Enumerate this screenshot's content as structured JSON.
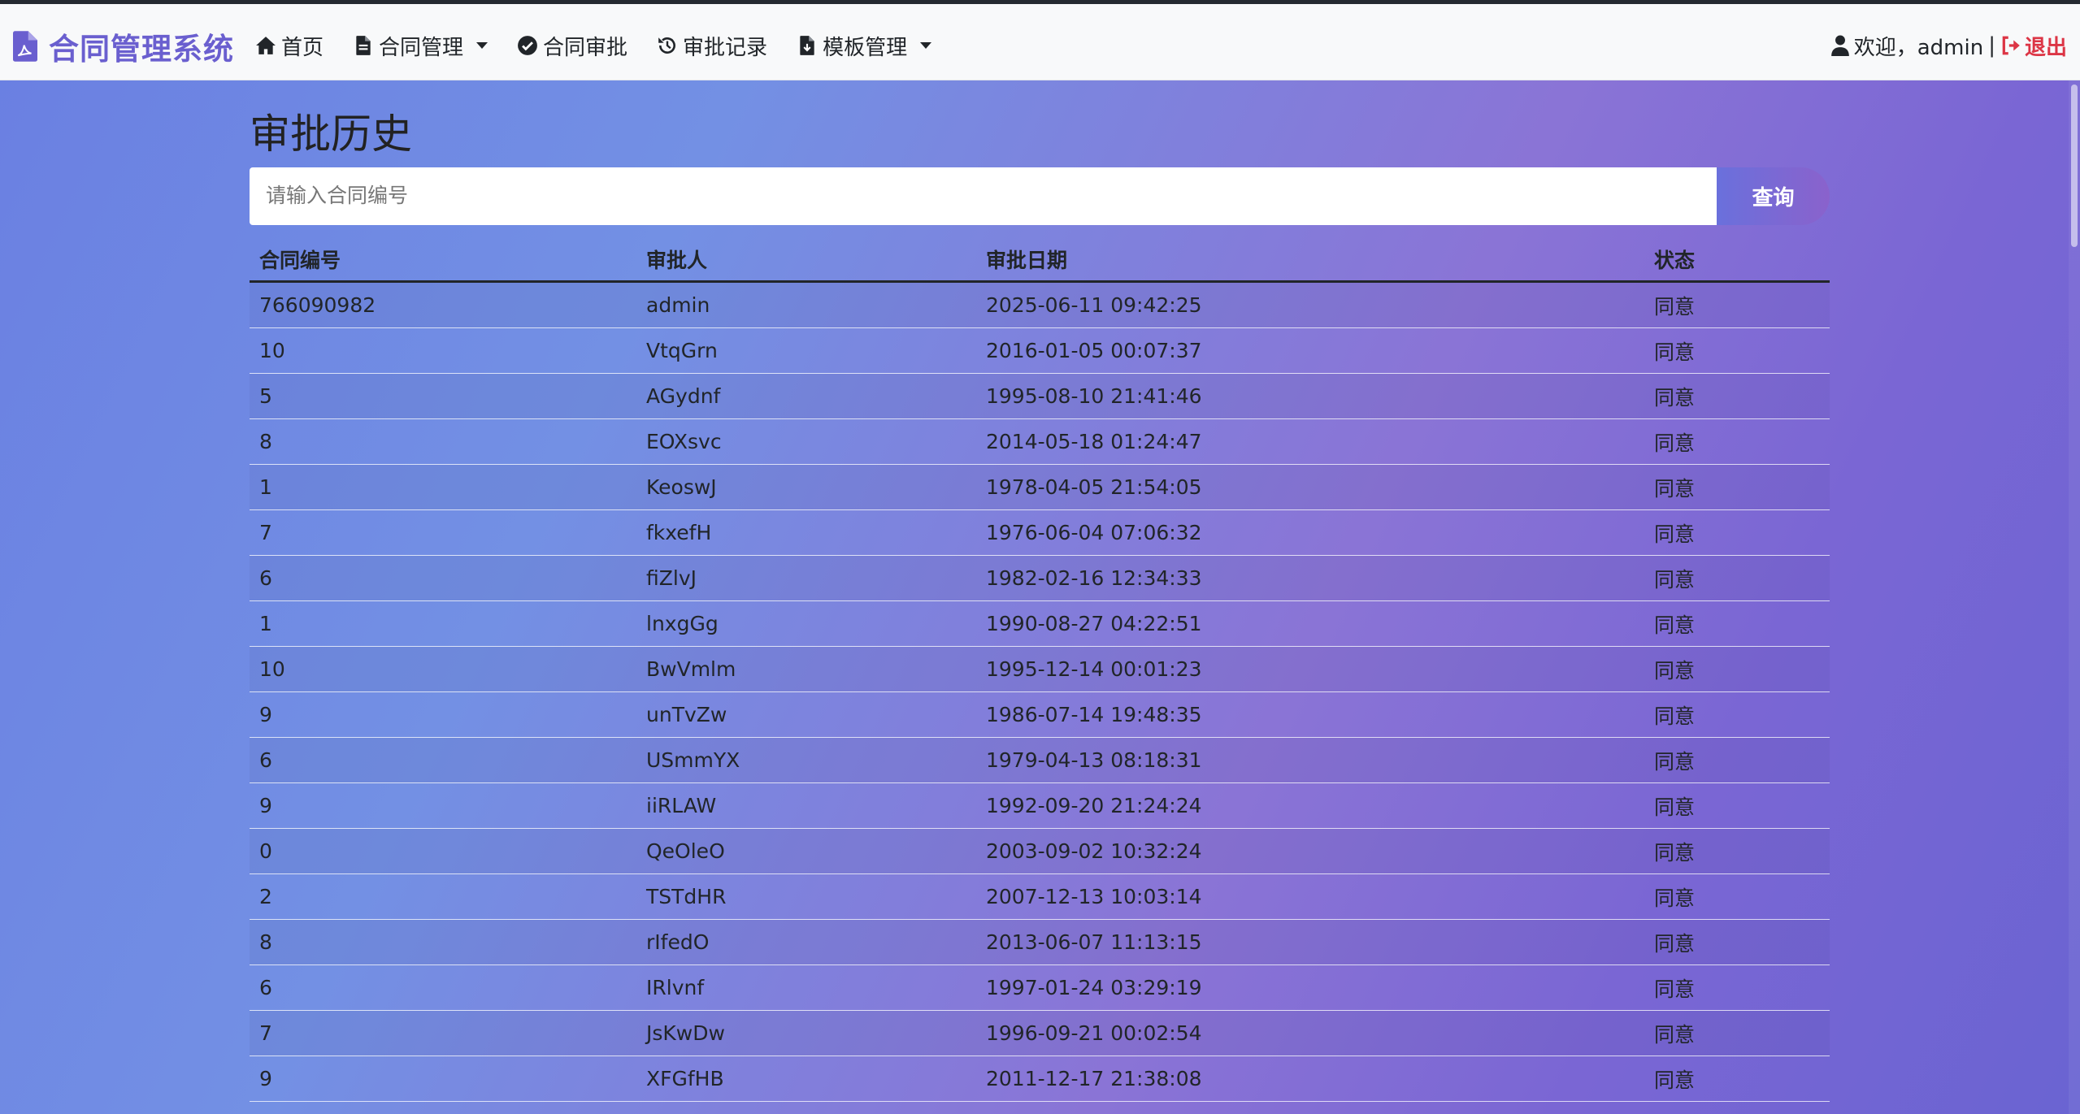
{
  "app": {
    "brand": "合同管理系统"
  },
  "nav": {
    "home": "首页",
    "contract_management": "合同管理",
    "contract_approval": "合同审批",
    "approval_records": "审批记录",
    "template_management": "模板管理"
  },
  "user": {
    "welcome": "欢迎，admin",
    "separator": "|",
    "logout": "退出"
  },
  "page": {
    "title": "审批历史"
  },
  "search": {
    "placeholder": "请输入合同编号",
    "button": "查询"
  },
  "table": {
    "headers": [
      "合同编号",
      "审批人",
      "审批日期",
      "状态"
    ],
    "rows": [
      [
        "766090982",
        "admin",
        "2025-06-11 09:42:25",
        "同意"
      ],
      [
        "10",
        "VtqGrn",
        "2016-01-05 00:07:37",
        "同意"
      ],
      [
        "5",
        "AGydnf",
        "1995-08-10 21:41:46",
        "同意"
      ],
      [
        "8",
        "EOXsvc",
        "2014-05-18 01:24:47",
        "同意"
      ],
      [
        "1",
        "KeoswJ",
        "1978-04-05 21:54:05",
        "同意"
      ],
      [
        "7",
        "fkxefH",
        "1976-06-04 07:06:32",
        "同意"
      ],
      [
        "6",
        "fiZlvJ",
        "1982-02-16 12:34:33",
        "同意"
      ],
      [
        "1",
        "lnxgGg",
        "1990-08-27 04:22:51",
        "同意"
      ],
      [
        "10",
        "BwVmlm",
        "1995-12-14 00:01:23",
        "同意"
      ],
      [
        "9",
        "unTvZw",
        "1986-07-14 19:48:35",
        "同意"
      ],
      [
        "6",
        "USmmYX",
        "1979-04-13 08:18:31",
        "同意"
      ],
      [
        "9",
        "iiRLAW",
        "1992-09-20 21:24:24",
        "同意"
      ],
      [
        "0",
        "QeOleO",
        "2003-09-02 10:32:24",
        "同意"
      ],
      [
        "2",
        "TSTdHR",
        "2007-12-13 10:03:14",
        "同意"
      ],
      [
        "8",
        "rIfedO",
        "2013-06-07 11:13:15",
        "同意"
      ],
      [
        "6",
        "IRlvnf",
        "1997-01-24 03:29:19",
        "同意"
      ],
      [
        "7",
        "JsKwDw",
        "1996-09-21 00:02:54",
        "同意"
      ],
      [
        "9",
        "XFGfHB",
        "2011-12-17 21:38:08",
        "同意"
      ]
    ]
  },
  "icons": {
    "brand": "file-pdf-icon",
    "home": "home-icon",
    "contract_management": "file-icon",
    "contract_approval": "check-circle-icon",
    "approval_records": "history-icon",
    "template_management": "file-download-icon",
    "user": "user-icon",
    "logout": "sign-out-icon"
  },
  "colors": {
    "brand": "#6a5fcf",
    "logout": "#dc3545",
    "navbar_bg": "#f8f9fa"
  }
}
